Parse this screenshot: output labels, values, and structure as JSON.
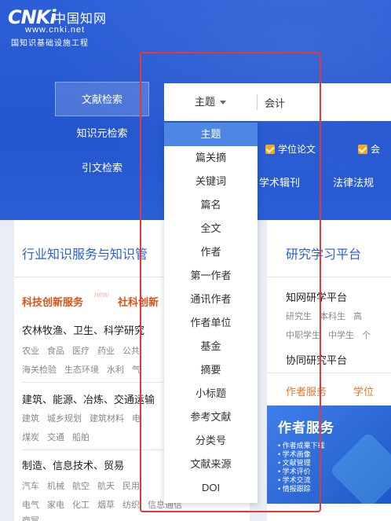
{
  "logo": {
    "brand": "CNKi",
    "name_cn": "中国知网",
    "url": "www.cnki.net",
    "subtitle": "国知识基础设施工程"
  },
  "left_tabs": [
    {
      "label": "文献检索",
      "active": true
    },
    {
      "label": "知识元检索",
      "active": false
    },
    {
      "label": "引文检索",
      "active": false
    }
  ],
  "search": {
    "field_label": "主题",
    "input_value": "会计"
  },
  "checks": [
    {
      "label": "学位论文",
      "checked": true
    },
    {
      "label": "会",
      "checked": true
    }
  ],
  "nav2": [
    "学术辑刊",
    "法律法规"
  ],
  "dropdown": {
    "items": [
      "主题",
      "篇关摘",
      "关键词",
      "篇名",
      "全文",
      "作者",
      "第一作者",
      "通讯作者",
      "作者单位",
      "基金",
      "摘要",
      "小标题",
      "参考文献",
      "分类号",
      "文献来源",
      "DOI"
    ],
    "selected_index": 0
  },
  "left_panel": {
    "title": "行业知识服务与知识管",
    "service_a": "科技创新服务",
    "new_tag": "new",
    "service_b": "社科创新",
    "categories": [
      {
        "title": "农林牧渔、卫生、科学研究",
        "tags_row1": [
          "农业",
          "食品",
          "医疗",
          "药业",
          "公共"
        ],
        "tags_row2": [
          "海关检验",
          "生态环境",
          "水利",
          "气"
        ]
      },
      {
        "title": "建筑、能源、冶炼、交通运输",
        "tags_row1": [
          "建筑",
          "城乡规划",
          "建筑材料",
          "电"
        ],
        "tags_row2": [
          "煤炭",
          "交通",
          "船舶"
        ]
      },
      {
        "title": "制造、信息技术、贸易",
        "tags_row1": [
          "汽车",
          "机械",
          "航空",
          "航天",
          "民用"
        ],
        "tags_row2": [
          "电气",
          "家电",
          "化工",
          "烟草",
          "纺织",
          "信息通信"
        ],
        "tags_row3": [
          "商贸"
        ]
      }
    ]
  },
  "right_panel": {
    "title": "研究学习平台",
    "platform1": "知网研学平台",
    "platform1_tags_row1": [
      "研究生",
      "本科生",
      "高"
    ],
    "platform1_tags_row2": [
      "中职学生",
      "中学生",
      "个"
    ],
    "platform2": "协同研究平台",
    "service_a": "作者服务",
    "service_b": "学位",
    "banner": {
      "title": "作者服务",
      "items": [
        "作者成果下载",
        "学术画像",
        "文献管理",
        "学术评价",
        "学术交流",
        "情报跟踪"
      ]
    }
  },
  "colors": {
    "brand_blue": "#2456cf",
    "accent_orange": "#f5a623",
    "highlight_red": "#e53935",
    "selected_blue": "#4e86e4"
  }
}
